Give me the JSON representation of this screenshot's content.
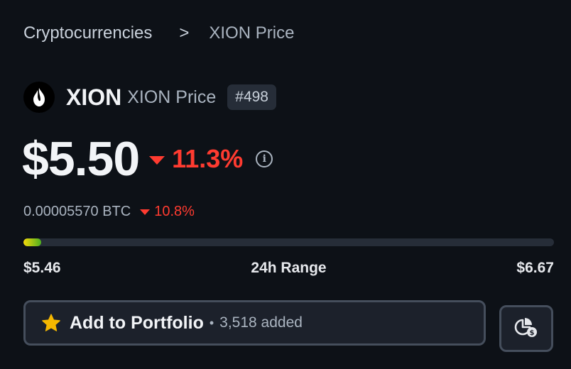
{
  "breadcrumb": {
    "parent": "Cryptocurrencies",
    "separator": ">",
    "current": "XION Price"
  },
  "coin": {
    "symbol": "XION",
    "name_label": "XION Price",
    "rank": "#498",
    "logo_icon": "xion-flame-logo"
  },
  "price": {
    "usd": "$5.50",
    "change_24h": "11.3%",
    "change_direction": "down",
    "info_icon": "info-icon"
  },
  "btc": {
    "value": "0.00005570 BTC",
    "change": "10.8%",
    "change_direction": "down"
  },
  "range": {
    "low": "$5.46",
    "label": "24h Range",
    "high": "$6.67",
    "current_fraction": 0.0331
  },
  "actions": {
    "portfolio_label": "Add to Portfolio",
    "portfolio_separator": "•",
    "portfolio_count": "3,518 added",
    "star_icon": "star-icon",
    "portfolio_chart_icon": "portfolio-pie-dollar-icon"
  },
  "colors": {
    "background": "#0d1117",
    "negative": "#ff3b30",
    "star": "#f5b700",
    "range_start": "#f5d90a",
    "range_end": "#4caf20"
  }
}
